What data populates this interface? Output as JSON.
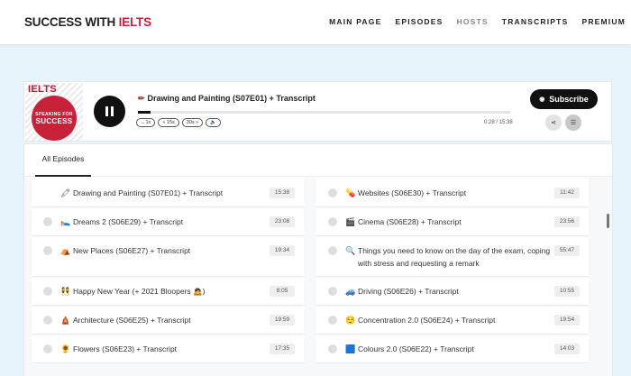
{
  "header": {
    "logo_prefix": "SUCCESS WITH ",
    "logo_brand": "IELTS",
    "nav": [
      "MAIN PAGE",
      "EPISODES",
      "HOSTS",
      "TRANSCRIPTS",
      "PREMIUM"
    ],
    "active_nav": "HOSTS"
  },
  "player": {
    "cover": {
      "line1": "IELTS",
      "line2": "SPEAKING FOR",
      "line3": "SUCCESS"
    },
    "title": "Drawing and Painting (S07E01) + Transcript",
    "title_icon": "pencil-icon",
    "progress": 0.035,
    "speed": "1x",
    "rewind": "15s",
    "forward": "30s",
    "volume_icon": "speaker-icon",
    "current_time": "0:28",
    "separator": "/",
    "duration": "15:38",
    "subscribe_label": "Subscribe",
    "share_icon": "share-icon",
    "playlist_icon": "list-icon"
  },
  "episodes": {
    "tab": "All Episodes",
    "items": [
      {
        "emoji": "🖍",
        "title": "Drawing and Painting (S07E01) + Transcript",
        "duration": "15:38",
        "playing": true
      },
      {
        "emoji": "💊",
        "title": "Websites (S06E30) + Transcript",
        "duration": "11:42"
      },
      {
        "emoji": "🛌",
        "title": "Dreams 2 (S06E29) + Transcript",
        "duration": "23:08"
      },
      {
        "emoji": "🎬",
        "title": "Cinema (S06E28) + Transcript",
        "duration": "23:56"
      },
      {
        "emoji": "⛺",
        "title": "New Places (S06E27) + Transcript",
        "duration": "19:34"
      },
      {
        "emoji": "🔍",
        "title": "Things you need to know on the day of the exam, coping",
        "title2": "with stress and requesting a remark",
        "duration": "55:47"
      },
      {
        "emoji": "👯",
        "title": "Happy New Year (+ 2021 Bloopers 🙇)",
        "duration": "8:05"
      },
      {
        "emoji": "🚙",
        "title": "Driving (S06E26) + Transcript",
        "duration": "10:55"
      },
      {
        "emoji": "🛕",
        "title": "Architecture (S06E25) + Transcript",
        "duration": "19:59"
      },
      {
        "emoji": "😌",
        "title": "Concentration 2.0 (S06E24) + Transcript",
        "duration": "19:54"
      },
      {
        "emoji": "🌻",
        "title": "Flowers (S06E23) + Transcript",
        "duration": "17:35"
      },
      {
        "emoji": "🟦",
        "title": "Colours 2.0 (S06E22) + Transcript",
        "duration": "14:03"
      }
    ]
  }
}
